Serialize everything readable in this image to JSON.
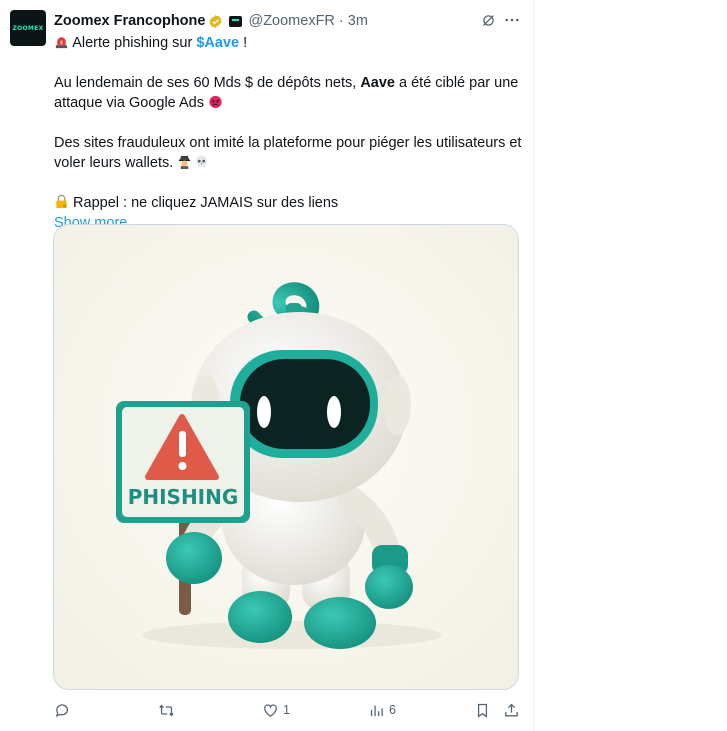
{
  "tweet": {
    "avatar_text": "ZOOMEX",
    "author_name": "Zoomex Francophone",
    "handle": "@ZoomexFR",
    "separator": "·",
    "time": "3m",
    "line1_text": " Alerte phishing sur ",
    "line1_mention": "$Aave",
    "line1_end": " !",
    "p2_a": "Au lendemain de ses 60 Mds $ de dépôts nets, ",
    "p2_bold": "Aave",
    "p2_b": " a été ciblé par une",
    "p2_line2": "attaque via Google Ads ",
    "p3_line1": "Des sites frauduleux ont imité la plateforme pour piéger les utilisateurs et",
    "p3_line2": "voler leurs wallets. ",
    "p4_line1": " Rappel : ne cliquez JAMAIS sur des liens",
    "show_more": "Show more",
    "media": {
      "sign_text": "PHISHING"
    }
  },
  "actions": {
    "reply_count": "",
    "retweet_count": "",
    "like_count": "1",
    "views_count": "6"
  },
  "colors": {
    "accent": "#1d9bf0",
    "secondary_text": "#536471",
    "teal": "#1fae9c"
  }
}
